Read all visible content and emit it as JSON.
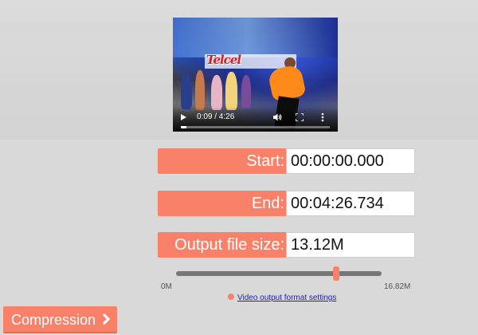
{
  "video": {
    "time_display": "0:09 / 4:26",
    "progress": 0.035,
    "sign_text": "Telcel"
  },
  "form": {
    "start_label": "Start:",
    "start_value": "00:00:00.000",
    "end_label": "End:",
    "end_value": "00:04:26.734",
    "size_label": "Output file size:",
    "size_value": "13.12M"
  },
  "slider": {
    "min_label": "0M",
    "max_label": "16.82M",
    "value_mb": 13.12,
    "max_mb": 16.82
  },
  "settings_link": "Video output format settings",
  "compression_button": "Compression",
  "colors": {
    "accent": "#f98169",
    "link": "#1a1ad4"
  },
  "icons": [
    "play-icon",
    "volume-icon",
    "fullscreen-icon",
    "more-icon",
    "gear-icon",
    "chevron-right-icon"
  ]
}
